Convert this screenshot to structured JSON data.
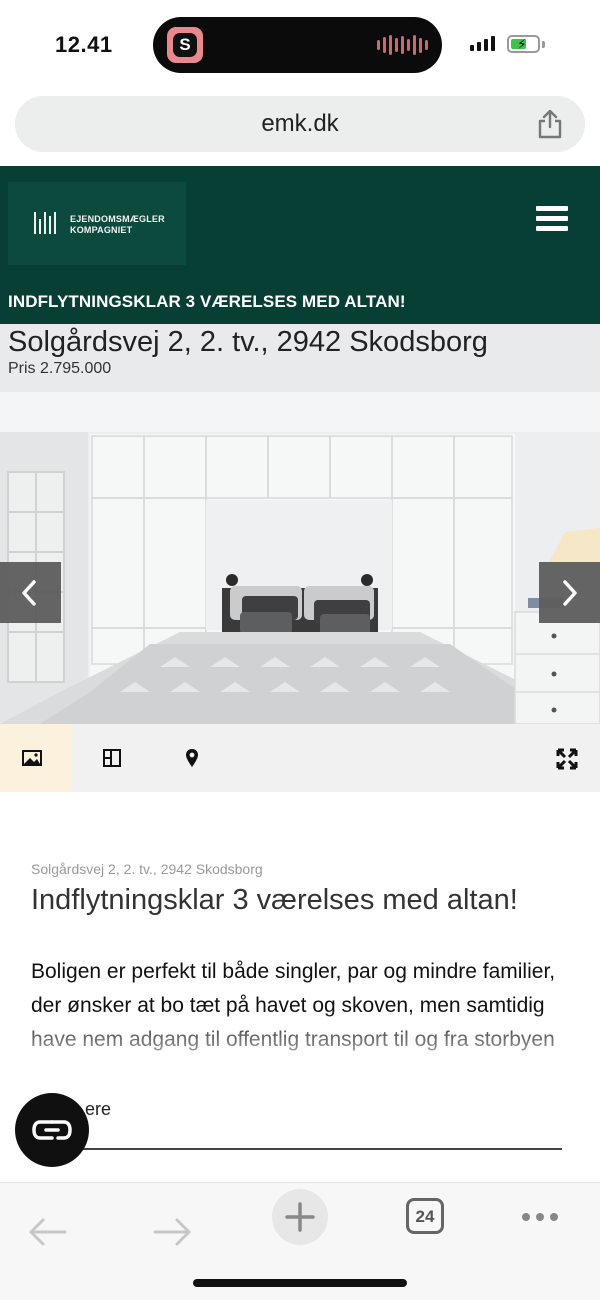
{
  "status_bar": {
    "time": "12.41"
  },
  "browser": {
    "url": "emk.dk",
    "tab_count": "24"
  },
  "site": {
    "logo_line1": "EJENDOMSMÆGLER",
    "logo_line2": "KOMPAGNIET",
    "tagline": "INDFLYTNINGSKLAR 3 VÆRELSES MED ALTAN!",
    "brand_color": "#073f34"
  },
  "listing": {
    "address": "Solgårdsvej 2, 2. tv., 2942 Skodsborg",
    "price": "Pris 2.795.000"
  },
  "gallery": {
    "image_description_icon": "bedroom-photo",
    "tools": [
      "photos-icon",
      "floorplan-icon",
      "map-pin-icon",
      "fullscreen-icon"
    ],
    "active_tool": "photos-icon"
  },
  "content": {
    "breadcrumb": "Solgårdsvej 2, 2. tv., 2942 Skodsborg",
    "title": "Indflytningsklar 3 værelses med altan!",
    "description": "Boligen er perfekt til både singler, par og mindre familier, der ønsker at bo tæt på havet og skoven, men samtidig have nem adgang til offentlig transport til og fra storbyen",
    "read_more": "ere"
  }
}
